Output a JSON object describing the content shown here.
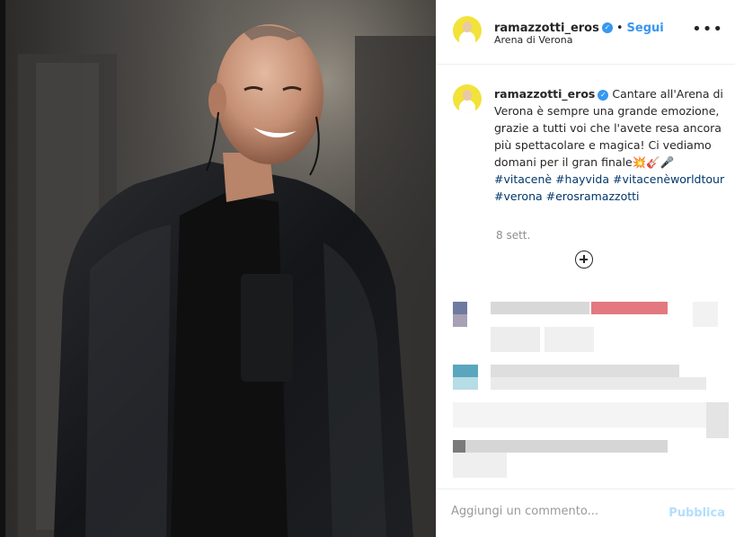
{
  "post": {
    "username": "ramazzotti_eros",
    "verified_symbol": "✓",
    "separator": "•",
    "follow_label": "Segui",
    "location": "Arena di Verona",
    "more_symbol": "•••",
    "caption_text": "Cantare all'Arena di Verona è sempre una grande emozione, grazie a tutti voi che l'avete resa ancora più spettacolare e magica! Ci vediamo domani per il gran finale💥🎸🎤",
    "hashtags": [
      "#vitacenè",
      "#hayvida",
      "#vitacenèworldtour",
      "#verona",
      "#erosramazzotti"
    ],
    "time_ago": "8 sett.",
    "add_comment_placeholder": "Aggiungi un commento...",
    "publish_label": "Pubblica"
  },
  "icons": {
    "more": "more-options-icon",
    "verified": "verified-badge-icon",
    "load_more": "plus-circle-icon"
  },
  "colors": {
    "accent": "#3897f0",
    "hashtag": "#00376b",
    "muted": "#8e8e8e",
    "avatar_bg": "#f2e23a",
    "publish_disabled": "#b2dffc"
  }
}
